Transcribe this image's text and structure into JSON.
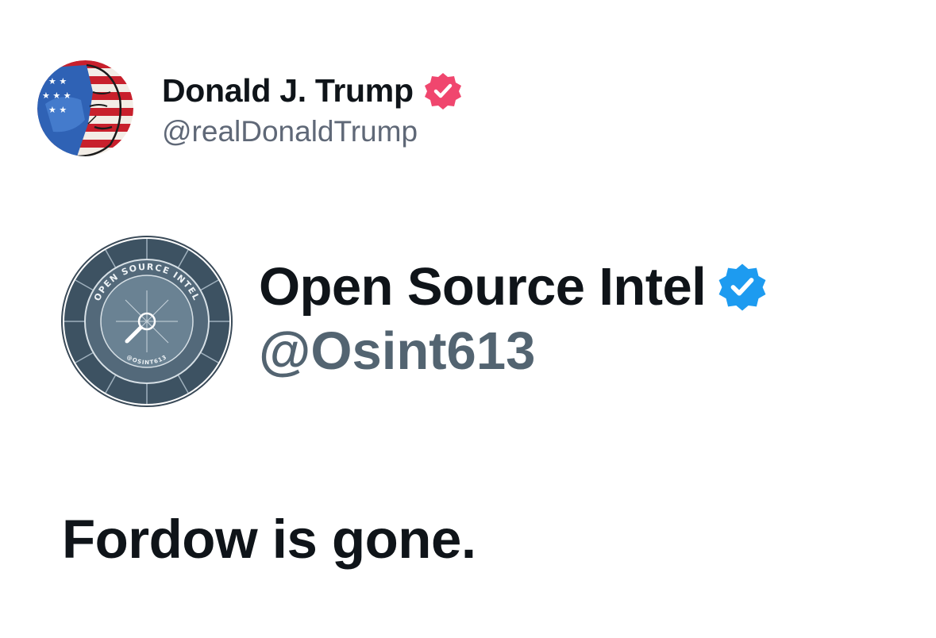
{
  "post": {
    "author_name": "Donald J. Trump",
    "author_handle": "@realDonaldTrump",
    "verified_icon": "verified-badge-icon",
    "badge_color": "#f0466e"
  },
  "quoted_post": {
    "account_name": "Open Source Intel",
    "account_handle": "@Osint613",
    "verified_icon": "verified-badge-icon",
    "badge_color": "#1d9bf0",
    "logo": {
      "ring_title": "OPEN SOURCE INTEL",
      "ring_handle": "@OSINT613"
    },
    "text": "Fordow is gone."
  }
}
